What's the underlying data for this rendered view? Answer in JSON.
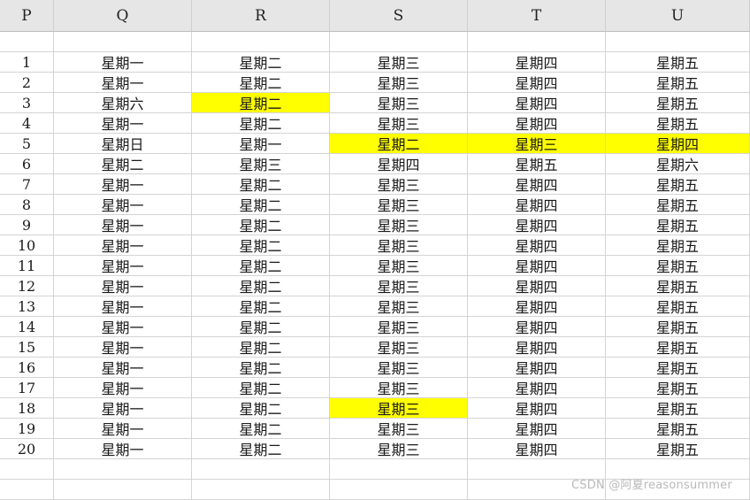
{
  "columns": [
    "P",
    "Q",
    "R",
    "S",
    "T",
    "U"
  ],
  "rows": [
    {
      "P": "",
      "Q": "",
      "R": "",
      "S": "",
      "T": "",
      "U": ""
    },
    {
      "P": "1",
      "Q": "星期一",
      "R": "星期二",
      "S": "星期三",
      "T": "星期四",
      "U": "星期五"
    },
    {
      "P": "2",
      "Q": "星期一",
      "R": "星期二",
      "S": "星期三",
      "T": "星期四",
      "U": "星期五"
    },
    {
      "P": "3",
      "Q": "星期六",
      "R": "星期二",
      "S": "星期三",
      "T": "星期四",
      "U": "星期五"
    },
    {
      "P": "4",
      "Q": "星期一",
      "R": "星期二",
      "S": "星期三",
      "T": "星期四",
      "U": "星期五"
    },
    {
      "P": "5",
      "Q": "星期日",
      "R": "星期一",
      "S": "星期二",
      "T": "星期三",
      "U": "星期四"
    },
    {
      "P": "6",
      "Q": "星期二",
      "R": "星期三",
      "S": "星期四",
      "T": "星期五",
      "U": "星期六"
    },
    {
      "P": "7",
      "Q": "星期一",
      "R": "星期二",
      "S": "星期三",
      "T": "星期四",
      "U": "星期五"
    },
    {
      "P": "8",
      "Q": "星期一",
      "R": "星期二",
      "S": "星期三",
      "T": "星期四",
      "U": "星期五"
    },
    {
      "P": "9",
      "Q": "星期一",
      "R": "星期二",
      "S": "星期三",
      "T": "星期四",
      "U": "星期五"
    },
    {
      "P": "10",
      "Q": "星期一",
      "R": "星期二",
      "S": "星期三",
      "T": "星期四",
      "U": "星期五"
    },
    {
      "P": "11",
      "Q": "星期一",
      "R": "星期二",
      "S": "星期三",
      "T": "星期四",
      "U": "星期五"
    },
    {
      "P": "12",
      "Q": "星期一",
      "R": "星期二",
      "S": "星期三",
      "T": "星期四",
      "U": "星期五"
    },
    {
      "P": "13",
      "Q": "星期一",
      "R": "星期二",
      "S": "星期三",
      "T": "星期四",
      "U": "星期五"
    },
    {
      "P": "14",
      "Q": "星期一",
      "R": "星期二",
      "S": "星期三",
      "T": "星期四",
      "U": "星期五"
    },
    {
      "P": "15",
      "Q": "星期一",
      "R": "星期二",
      "S": "星期三",
      "T": "星期四",
      "U": "星期五"
    },
    {
      "P": "16",
      "Q": "星期一",
      "R": "星期二",
      "S": "星期三",
      "T": "星期四",
      "U": "星期五"
    },
    {
      "P": "17",
      "Q": "星期一",
      "R": "星期二",
      "S": "星期三",
      "T": "星期四",
      "U": "星期五"
    },
    {
      "P": "18",
      "Q": "星期一",
      "R": "星期二",
      "S": "星期三",
      "T": "星期四",
      "U": "星期五"
    },
    {
      "P": "19",
      "Q": "星期一",
      "R": "星期二",
      "S": "星期三",
      "T": "星期四",
      "U": "星期五"
    },
    {
      "P": "20",
      "Q": "星期一",
      "R": "星期二",
      "S": "星期三",
      "T": "星期四",
      "U": "星期五"
    },
    {
      "P": "",
      "Q": "",
      "R": "",
      "S": "",
      "T": "",
      "U": ""
    },
    {
      "P": "",
      "Q": "",
      "R": "",
      "S": "",
      "T": "",
      "U": ""
    }
  ],
  "highlights": [
    {
      "row": 3,
      "col": "R"
    },
    {
      "row": 5,
      "col": "S"
    },
    {
      "row": 5,
      "col": "T"
    },
    {
      "row": 5,
      "col": "U"
    },
    {
      "row": 18,
      "col": "S"
    }
  ],
  "highlight_color": "#ffff00",
  "watermark": "CSDN @阿夏reasonsummer"
}
